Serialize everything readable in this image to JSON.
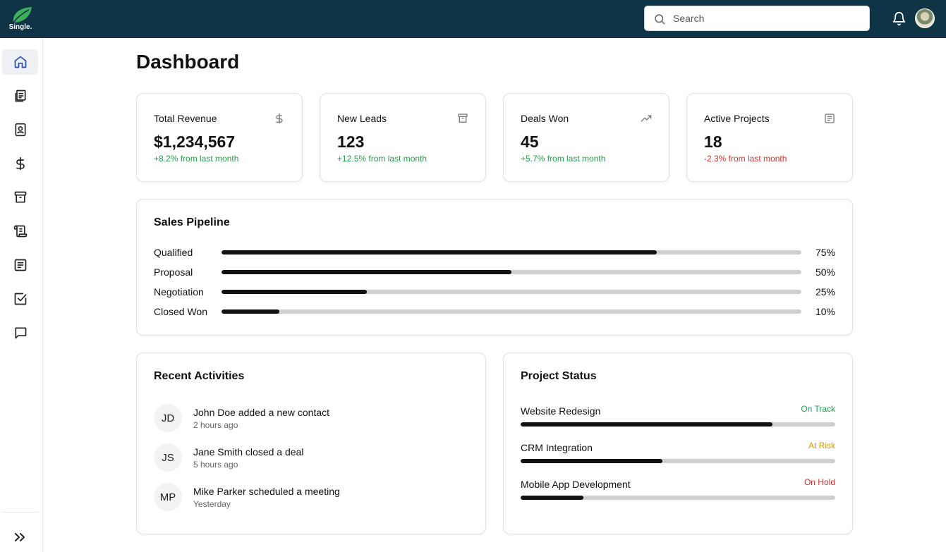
{
  "app": {
    "logo_text": "Single.",
    "brand_color": "#0f3446",
    "logo_color": "#3db05a"
  },
  "header": {
    "search_placeholder": "Search",
    "bell_icon": "bell-icon",
    "avatar_icon": "user-avatar"
  },
  "sidebar": {
    "items": [
      {
        "name": "home",
        "icon": "home-icon",
        "active": true
      },
      {
        "name": "documents",
        "icon": "documents-icon",
        "active": false
      },
      {
        "name": "contacts",
        "icon": "contact-book-icon",
        "active": false
      },
      {
        "name": "finance",
        "icon": "dollar-icon",
        "active": false
      },
      {
        "name": "archive",
        "icon": "archive-icon",
        "active": false
      },
      {
        "name": "scroll",
        "icon": "scroll-icon",
        "active": false
      },
      {
        "name": "notes",
        "icon": "note-icon",
        "active": false
      },
      {
        "name": "tasks",
        "icon": "checkbox-icon",
        "active": false
      },
      {
        "name": "messages",
        "icon": "chat-icon",
        "active": false
      }
    ],
    "collapse_icon": "double-chevron-right-icon"
  },
  "page": {
    "title": "Dashboard"
  },
  "stats": [
    {
      "label": "Total Revenue",
      "value": "$1,234,567",
      "change": "+8.2% from last month",
      "trend": "positive",
      "icon": "dollar-icon"
    },
    {
      "label": "New Leads",
      "value": "123",
      "change": "+12.5% from last month",
      "trend": "positive",
      "icon": "archive-icon"
    },
    {
      "label": "Deals Won",
      "value": "45",
      "change": "+5.7% from last month",
      "trend": "positive",
      "icon": "trending-up-icon"
    },
    {
      "label": "Active Projects",
      "value": "18",
      "change": "-2.3% from last month",
      "trend": "negative",
      "icon": "note-icon"
    }
  ],
  "pipeline": {
    "title": "Sales Pipeline",
    "stages": [
      {
        "label": "Qualified",
        "percent": 75,
        "percent_label": "75%"
      },
      {
        "label": "Proposal",
        "percent": 50,
        "percent_label": "50%"
      },
      {
        "label": "Negotiation",
        "percent": 25,
        "percent_label": "25%"
      },
      {
        "label": "Closed Won",
        "percent": 10,
        "percent_label": "10%"
      }
    ]
  },
  "activities": {
    "title": "Recent Activities",
    "items": [
      {
        "initials": "JD",
        "text": "John Doe added a new contact",
        "time": "2 hours ago"
      },
      {
        "initials": "JS",
        "text": "Jane Smith closed a deal",
        "time": "5 hours ago"
      },
      {
        "initials": "MP",
        "text": "Mike Parker scheduled a meeting",
        "time": "Yesterday"
      }
    ]
  },
  "projects": {
    "title": "Project Status",
    "items": [
      {
        "name": "Website Redesign",
        "status": "On Track",
        "status_color": "#22a04b",
        "progress": 80
      },
      {
        "name": "CRM Integration",
        "status": "At Risk",
        "status_color": "#d89a00",
        "progress": 45
      },
      {
        "name": "Mobile App Development",
        "status": "On Hold",
        "status_color": "#dc2f2f",
        "progress": 20
      }
    ]
  },
  "colors": {
    "positive": "#22a04b",
    "negative": "#dc2f2f",
    "bar": "#111111",
    "track": "#cfcfcf"
  }
}
